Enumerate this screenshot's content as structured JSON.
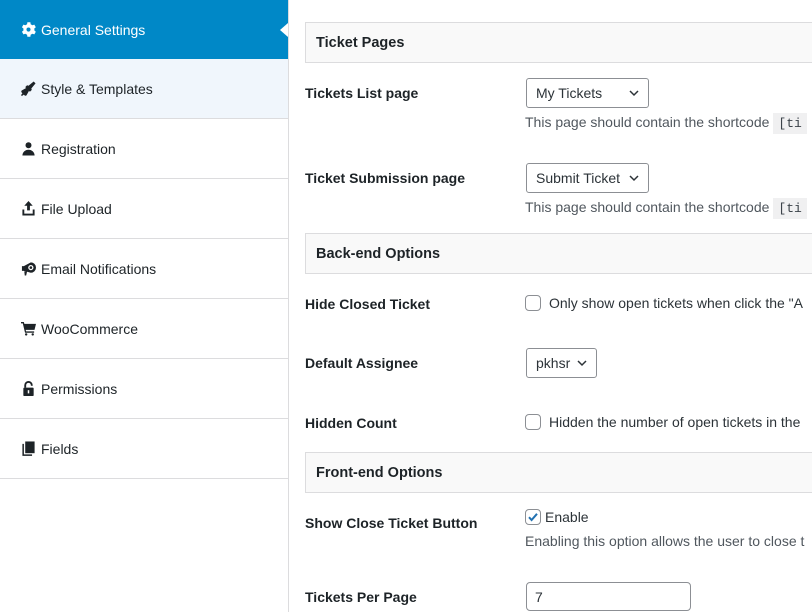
{
  "sidebar": {
    "items": [
      {
        "label": "General Settings",
        "icon": "gear-icon",
        "active": true
      },
      {
        "label": "Style & Templates",
        "icon": "paintbrush-icon"
      },
      {
        "label": "Registration",
        "icon": "user-icon"
      },
      {
        "label": "File Upload",
        "icon": "upload-icon"
      },
      {
        "label": "Email Notifications",
        "icon": "megaphone-icon"
      },
      {
        "label": "WooCommerce",
        "icon": "cart-icon"
      },
      {
        "label": "Permissions",
        "icon": "unlock-icon"
      },
      {
        "label": "Fields",
        "icon": "copy-icon"
      }
    ]
  },
  "colors": {
    "accent": "#0088c7",
    "hover_bg": "#f0f6fc",
    "check": "#2271b1"
  },
  "sections": {
    "ticket_pages": {
      "title": "Ticket Pages",
      "tickets_list": {
        "label": "Tickets List page",
        "selected": "My Tickets",
        "desc": "This page should contain the shortcode",
        "shortcode_partial": "[ti"
      },
      "ticket_submission": {
        "label": "Ticket Submission page",
        "selected": "Submit Ticket",
        "desc": "This page should contain the shortcode",
        "shortcode_partial": "[ti"
      }
    },
    "backend": {
      "title": "Back-end Options",
      "hide_closed": {
        "label": "Hide Closed Ticket",
        "checked": false,
        "text": "Only show open tickets when click the \"A"
      },
      "default_assignee": {
        "label": "Default Assignee",
        "selected": "pkhsr"
      },
      "hidden_count": {
        "label": "Hidden Count",
        "checked": false,
        "text": "Hidden the number of open tickets in the"
      }
    },
    "frontend": {
      "title": "Front-end Options",
      "show_close": {
        "label": "Show Close Ticket Button",
        "checked": true,
        "text": "Enable",
        "desc": "Enabling this option allows the user to close t"
      },
      "per_page": {
        "label": "Tickets Per Page",
        "value": "7"
      }
    }
  }
}
